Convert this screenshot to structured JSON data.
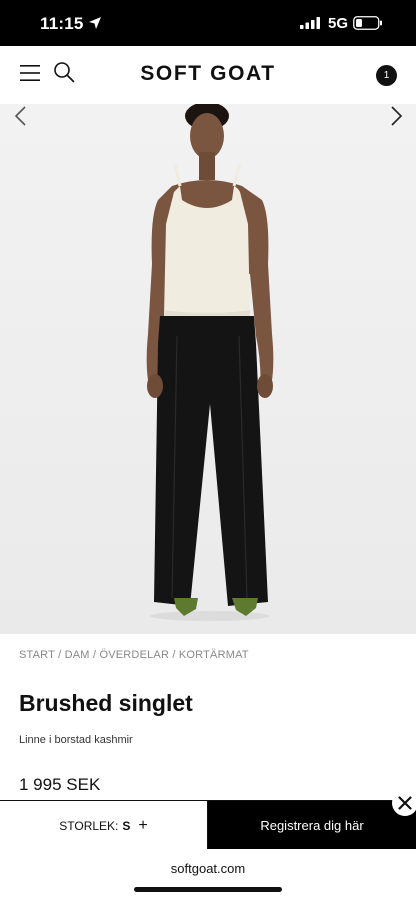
{
  "status_bar": {
    "time": "11:15",
    "network": "5G",
    "icons": [
      "location-arrow-icon",
      "signal-icon",
      "battery-icon"
    ]
  },
  "header": {
    "logo": "SOFT GOAT",
    "cart_count": "1",
    "icons": [
      "menu-icon",
      "search-icon"
    ]
  },
  "product": {
    "breadcrumb": [
      "START",
      "DAM",
      "ÖVERDELAR",
      "KORTÄRMAT"
    ],
    "title": "Brushed singlet",
    "subtitle": "Linne i borstad kashmir",
    "price": "1 995 SEK",
    "image_alt": "Model wearing brushed singlet and black trousers"
  },
  "bottom_bar": {
    "size_label": "STORLEK:",
    "size_value": "S",
    "plus": "+",
    "register_label": "Registrera dig här"
  },
  "browser": {
    "url": "softgoat.com"
  },
  "colors": {
    "background": "#ffffff",
    "status_bar": "#000000",
    "accent": "#000000",
    "hero_bg": "#efefef"
  }
}
